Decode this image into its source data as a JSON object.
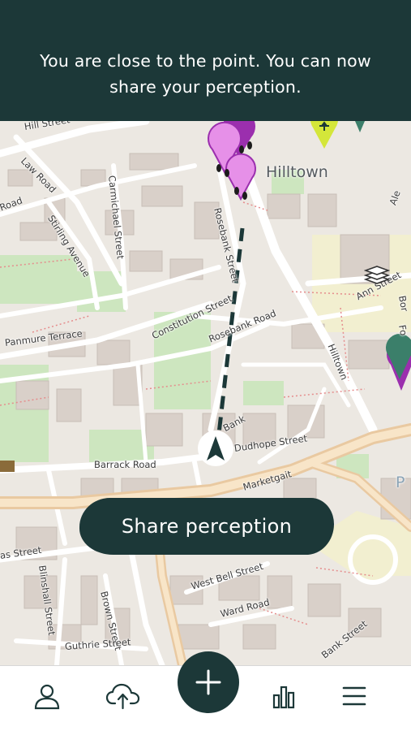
{
  "banner": {
    "message": "You are close to the point. You can now share your perception."
  },
  "map": {
    "places": [
      {
        "id": "hilltown",
        "label": "Hilltown"
      }
    ],
    "streets": [
      "Hill Street",
      "Law Road",
      "Road",
      "Carmichael Street",
      "Stirling Avenue",
      "Rosebank Street",
      "Constitution Street",
      "Rosebank Road",
      "Panmure Terrace",
      "Hilltown",
      "Ann Street",
      "Bank",
      "Dudhope Street",
      "Barrack Road",
      "Marketgait",
      "West Bell Street",
      "Blinshall Street",
      "Brown Street",
      "Ward Road",
      "Guthrie Street",
      "Bank Street",
      "as Street",
      "Ale",
      "Bor",
      "Fo",
      "P"
    ],
    "route_style": "dashed"
  },
  "actions": {
    "share_label": "Share perception"
  },
  "nav": {
    "items": [
      "profile",
      "upload",
      "add",
      "statistics",
      "menu"
    ]
  },
  "icons": {
    "layers": "layers-icon",
    "locate": "crosshair-icon",
    "user_arrow": "navigation-arrow-icon",
    "profile": "person-icon",
    "upload": "cloud-upload-icon",
    "add": "plus-icon",
    "stats": "bar-chart-icon",
    "menu": "hamburger-icon"
  },
  "colors": {
    "banner_bg": "#1c3838",
    "pin_pink": "#e690e8",
    "pin_purple": "#9b2fae",
    "pin_green": "#3b7f6a",
    "pin_yellow": "#d4e63a",
    "map_bg": "#ece8e2",
    "park": "#cde6bf"
  }
}
